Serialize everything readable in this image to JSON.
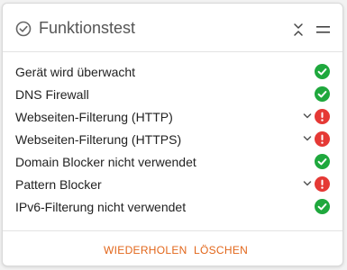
{
  "header": {
    "title": "Funktionstest"
  },
  "colors": {
    "ok": "#1fa83d",
    "error": "#e53935",
    "accent": "#e2661a"
  },
  "rows": [
    {
      "label": "Gerät wird überwacht",
      "status": "ok",
      "expandable": false
    },
    {
      "label": "DNS Firewall",
      "status": "ok",
      "expandable": false
    },
    {
      "label": "Webseiten-Filterung (HTTP)",
      "status": "error",
      "expandable": true
    },
    {
      "label": "Webseiten-Filterung (HTTPS)",
      "status": "error",
      "expandable": true
    },
    {
      "label": "Domain Blocker nicht verwendet",
      "status": "ok",
      "expandable": false
    },
    {
      "label": "Pattern Blocker",
      "status": "error",
      "expandable": true
    },
    {
      "label": "IPv6-Filterung nicht verwendet",
      "status": "ok",
      "expandable": false
    }
  ],
  "footer": {
    "repeat_label": "WIEDERHOLEN",
    "delete_label": "LÖSCHEN"
  }
}
